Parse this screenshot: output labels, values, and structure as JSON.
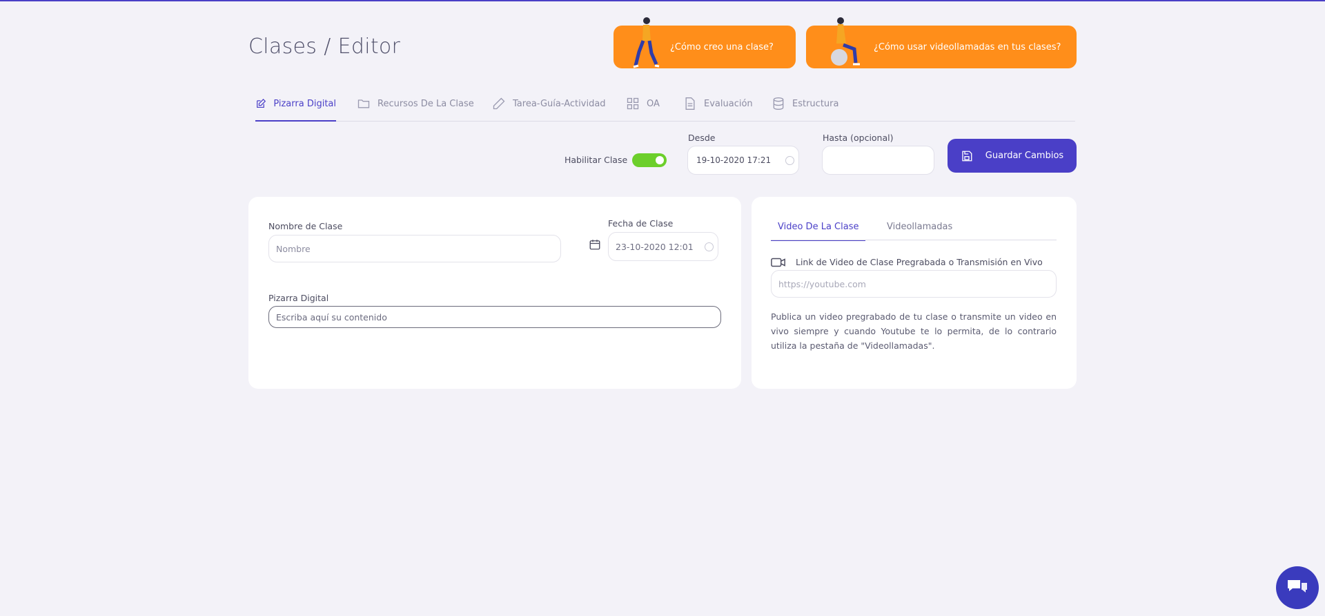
{
  "breadcrumb": {
    "section": "Clases",
    "separator": "/",
    "current": "Editor"
  },
  "help_buttons": [
    {
      "label": "¿Cómo creo una clase?"
    },
    {
      "label": "¿Cómo usar videollamadas en tus clases?"
    }
  ],
  "tabs": [
    {
      "label": "Pizarra Digital",
      "icon": "edit-icon",
      "active": true
    },
    {
      "label": "Recursos De La Clase",
      "icon": "folder-icon",
      "active": false
    },
    {
      "label": "Tarea-Guía-Actividad",
      "icon": "pencil-icon",
      "active": false
    },
    {
      "label": "OA",
      "icon": "grid-icon",
      "active": false
    },
    {
      "label": "Evaluación",
      "icon": "document-icon",
      "active": false
    },
    {
      "label": "Estructura",
      "icon": "database-icon",
      "active": false
    }
  ],
  "toolbar": {
    "enable_label": "Habilitar Clase",
    "enabled": true,
    "desde_label": "Desde",
    "desde_value": "19-10-2020 17:21",
    "hasta_label": "Hasta (opcional)",
    "hasta_value": "",
    "save_label": "Guardar Cambios"
  },
  "class_form": {
    "name_label": "Nombre de Clase",
    "name_placeholder": "Nombre",
    "date_label": "Fecha de Clase",
    "date_value": "23-10-2020 12:01",
    "board_label": "Pizarra Digital",
    "board_placeholder": "Escriba aquí su contenido"
  },
  "video_panel": {
    "tabs": [
      {
        "label": "Video De La Clase",
        "active": true
      },
      {
        "label": "Videollamadas",
        "active": false
      }
    ],
    "link_label": "Link de Video de Clase Pregrabada o Transmisión en Vivo",
    "link_placeholder": "https://youtube.com",
    "description": "Publica un video pregrabado de tu clase o transmite un video en vivo siempre y cuando Youtube te lo permita, de lo contrario utiliza la pestaña de \"Videollamadas\"."
  },
  "colors": {
    "accent": "#4a3fc7",
    "orange": "#ff8e1a",
    "toggle_on": "#6ccf2b",
    "background": "#f3f2f8"
  }
}
